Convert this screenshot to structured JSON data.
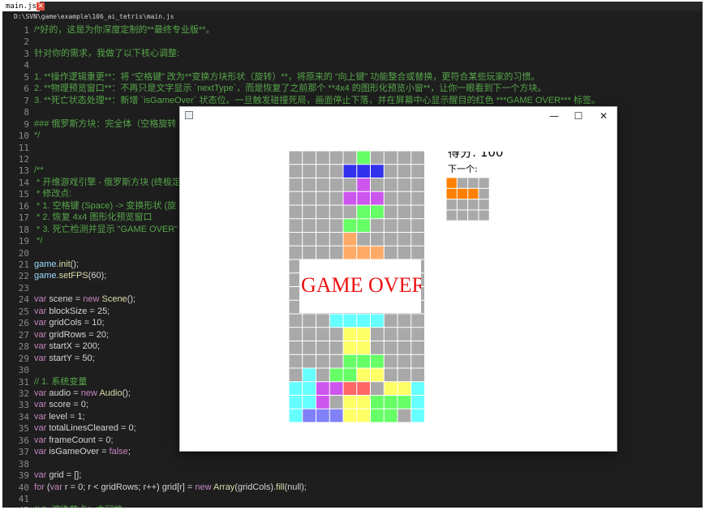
{
  "editor": {
    "tab_label": "main.js",
    "tab_close_glyph": "✕",
    "file_path": "D:\\SVN\\game\\example\\106_ai_tetris\\main.js",
    "colors": {
      "comment": "#57a64a",
      "keyword": "#c586c0",
      "function": "#dcdcaa",
      "variable": "#9cdcfe",
      "text": "#d4d4d4",
      "background": "#1e1e1e"
    },
    "lines": [
      {
        "n": "1",
        "parts": [
          {
            "t": "/*好的，这是为你深度定制的**最终专业版**。",
            "c": "comment"
          }
        ]
      },
      {
        "n": "2",
        "parts": []
      },
      {
        "n": "3",
        "parts": [
          {
            "t": "针对你的需求，我做了以下核心调整:",
            "c": "comment"
          }
        ]
      },
      {
        "n": "4",
        "parts": []
      },
      {
        "n": "5",
        "parts": [
          {
            "t": "1. **操作逻辑重更**：将 “空格键” 改为**变换方块形状（旋转）**，将原来的 “向上键” 功能整合或替换，更符合某些玩家的习惯。",
            "c": "comment"
          }
        ]
      },
      {
        "n": "6",
        "parts": [
          {
            "t": "2. **物理预览窗口**：不再只是文字显示 `nextType`，而是恢复了之前那个 **4x4 的图形化预览小窗**，让你一眼看到下一个方块。",
            "c": "comment"
          }
        ]
      },
      {
        "n": "7",
        "parts": [
          {
            "t": "3. **死亡状态处理**：新增 `isGameOver` 状态位。一旦触发碰撞死局，画面停止下落，并在屏幕中心显示醒目的红色 ***GAME OVER*** 标签。",
            "c": "comment"
          }
        ]
      },
      {
        "n": "8",
        "parts": []
      },
      {
        "n": "9",
        "parts": [
          {
            "t": "### 俄罗斯方块：完全体（空格旋转",
            "c": "comment"
          }
        ]
      },
      {
        "n": "10",
        "parts": [
          {
            "t": "*/",
            "c": "comment"
          }
        ]
      },
      {
        "n": "11",
        "parts": []
      },
      {
        "n": "12",
        "parts": []
      },
      {
        "n": "13",
        "parts": [
          {
            "t": "/**",
            "c": "comment"
          }
        ]
      },
      {
        "n": "14",
        "parts": [
          {
            "t": " * 开维游戏引擎 - 俄罗斯方块 (终极定",
            "c": "comment"
          }
        ]
      },
      {
        "n": "15",
        "parts": [
          {
            "t": " * 修改点:",
            "c": "comment"
          }
        ]
      },
      {
        "n": "16",
        "parts": [
          {
            "t": " * 1. 空格键 (Space) -> 变换形状 (旋",
            "c": "comment"
          }
        ]
      },
      {
        "n": "17",
        "parts": [
          {
            "t": " * 2. 恢复 4x4 图形化预览窗口",
            "c": "comment"
          }
        ]
      },
      {
        "n": "18",
        "parts": [
          {
            "t": " * 3. 死亡检测并显示 \"GAME OVER\"",
            "c": "comment"
          }
        ]
      },
      {
        "n": "19",
        "parts": [
          {
            "t": " */",
            "c": "comment"
          }
        ]
      },
      {
        "n": "20",
        "parts": []
      },
      {
        "n": "21",
        "parts": [
          {
            "t": "game",
            "c": "var"
          },
          {
            "t": ".",
            "c": "plain"
          },
          {
            "t": "init",
            "c": "fn"
          },
          {
            "t": "();",
            "c": "plain"
          }
        ]
      },
      {
        "n": "22",
        "parts": [
          {
            "t": "game",
            "c": "var"
          },
          {
            "t": ".",
            "c": "plain"
          },
          {
            "t": "setFPS",
            "c": "fn"
          },
          {
            "t": "(60);",
            "c": "plain"
          }
        ]
      },
      {
        "n": "23",
        "parts": []
      },
      {
        "n": "24",
        "parts": [
          {
            "t": "var",
            "c": "kw"
          },
          {
            "t": " scene = ",
            "c": "plain"
          },
          {
            "t": "new",
            "c": "kw"
          },
          {
            "t": " ",
            "c": "plain"
          },
          {
            "t": "Scene",
            "c": "fn"
          },
          {
            "t": "();",
            "c": "plain"
          }
        ]
      },
      {
        "n": "25",
        "parts": [
          {
            "t": "var",
            "c": "kw"
          },
          {
            "t": " blockSize = 25;",
            "c": "plain"
          }
        ]
      },
      {
        "n": "26",
        "parts": [
          {
            "t": "var",
            "c": "kw"
          },
          {
            "t": " gridCols = 10;",
            "c": "plain"
          }
        ]
      },
      {
        "n": "27",
        "parts": [
          {
            "t": "var",
            "c": "kw"
          },
          {
            "t": " gridRows = 20;",
            "c": "plain"
          }
        ]
      },
      {
        "n": "28",
        "parts": [
          {
            "t": "var",
            "c": "kw"
          },
          {
            "t": " startX = 200;",
            "c": "plain"
          }
        ]
      },
      {
        "n": "29",
        "parts": [
          {
            "t": "var",
            "c": "kw"
          },
          {
            "t": " startY = 50;",
            "c": "plain"
          }
        ]
      },
      {
        "n": "30",
        "parts": []
      },
      {
        "n": "31",
        "parts": [
          {
            "t": "// 1. 系统变量",
            "c": "comment"
          }
        ]
      },
      {
        "n": "32",
        "parts": [
          {
            "t": "var",
            "c": "kw"
          },
          {
            "t": " audio = ",
            "c": "plain"
          },
          {
            "t": "new",
            "c": "kw"
          },
          {
            "t": " ",
            "c": "plain"
          },
          {
            "t": "Audio",
            "c": "fn"
          },
          {
            "t": "();",
            "c": "plain"
          }
        ]
      },
      {
        "n": "33",
        "parts": [
          {
            "t": "var",
            "c": "kw"
          },
          {
            "t": " score = 0;",
            "c": "plain"
          }
        ]
      },
      {
        "n": "34",
        "parts": [
          {
            "t": "var",
            "c": "kw"
          },
          {
            "t": " level = 1;",
            "c": "plain"
          }
        ]
      },
      {
        "n": "35",
        "parts": [
          {
            "t": "var",
            "c": "kw"
          },
          {
            "t": " totalLinesCleared = 0;",
            "c": "plain"
          }
        ]
      },
      {
        "n": "36",
        "parts": [
          {
            "t": "var",
            "c": "kw"
          },
          {
            "t": " frameCount = 0;",
            "c": "plain"
          }
        ]
      },
      {
        "n": "37",
        "parts": [
          {
            "t": "var",
            "c": "kw"
          },
          {
            "t": " isGameOver = ",
            "c": "plain"
          },
          {
            "t": "false",
            "c": "kw"
          },
          {
            "t": ";",
            "c": "plain"
          }
        ]
      },
      {
        "n": "38",
        "parts": []
      },
      {
        "n": "39",
        "parts": [
          {
            "t": "var",
            "c": "kw"
          },
          {
            "t": " grid = [];",
            "c": "plain"
          }
        ]
      },
      {
        "n": "40",
        "parts": [
          {
            "t": "for",
            "c": "kw"
          },
          {
            "t": " (",
            "c": "plain"
          },
          {
            "t": "var",
            "c": "kw"
          },
          {
            "t": " r = 0; r < gridRows; r++) grid[r] = ",
            "c": "plain"
          },
          {
            "t": "new",
            "c": "kw"
          },
          {
            "t": " ",
            "c": "plain"
          },
          {
            "t": "Array",
            "c": "fn"
          },
          {
            "t": "(gridCols).",
            "c": "plain"
          },
          {
            "t": "fill",
            "c": "fn"
          },
          {
            "t": "(null);",
            "c": "plain"
          }
        ]
      },
      {
        "n": "41",
        "parts": []
      },
      {
        "n": "42",
        "parts": [
          {
            "t": "// 2. 渲染节点：主网格",
            "c": "comment"
          }
        ]
      }
    ]
  },
  "game_window": {
    "window_icon": "app-window-icon",
    "controls": {
      "minimize": "—",
      "maximize": "☐",
      "close": "✕"
    },
    "score_label": "得分: 100",
    "next_label": "下一个:",
    "game_over_text": "GAME OVER",
    "colors": {
      "gray": "#a9a9a9",
      "green": "#66ff66",
      "blue": "#3232ee",
      "purple": "#cc55ee",
      "orange": "#ffaa66",
      "cyan": "#66ffff",
      "yellow": "#ffff66",
      "red": "#ff6666",
      "periwinkle": "#8080f8",
      "next_orange": "#ff8000",
      "game_over_red": "#ee1111"
    },
    "board": {
      "cols": 10,
      "rows": 20,
      "cells": [
        "GGGGGgGGGG",
        "GGGGBBBGGG",
        "GGGGGPGGGG",
        "GGGGPPPGGG",
        "GGGGGggGGG",
        "GGGGggGGGG",
        "GGGGOGGGGG",
        "GGGGOOOGGG",
        "GGGGGGGGGG",
        "GGGGGGGGGG",
        "GGGGGGGGGG",
        "GGGGGGGGGG",
        "GGGCCCCGGG",
        "GGGGYYGGGG",
        "GGGGYYGGGG",
        "GGGGgggGGG",
        "GCGggYYGGG",
        "CCPPRRGYYC",
        "CCPGYYgggC",
        "CWWWYYggGC"
      ]
    },
    "next_piece": {
      "rows": [
        "OGGG",
        "OOOG",
        "GGGG",
        "GGGG"
      ]
    }
  }
}
